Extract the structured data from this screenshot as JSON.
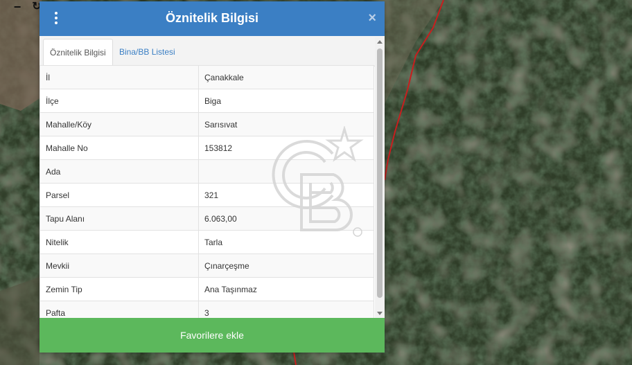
{
  "map": {
    "controls": [
      "−",
      "↻"
    ]
  },
  "panel": {
    "title": "Öznitelik Bilgisi",
    "close_label": "×",
    "tabs": [
      {
        "label": "Öznitelik Bilgisi",
        "active": true
      },
      {
        "label": "Bina/BB Listesi",
        "active": false
      }
    ],
    "rows": [
      {
        "label": "İl",
        "value": "Çanakkale"
      },
      {
        "label": "İlçe",
        "value": "Biga"
      },
      {
        "label": "Mahalle/Köy",
        "value": "Sarısıvat"
      },
      {
        "label": "Mahalle No",
        "value": "153812"
      },
      {
        "label": "Ada",
        "value": ""
      },
      {
        "label": "Parsel",
        "value": "321"
      },
      {
        "label": "Tapu Alanı",
        "value": "6.063,00"
      },
      {
        "label": "Nitelik",
        "value": "Tarla"
      },
      {
        "label": "Mevkii",
        "value": "Çınarçeşme"
      },
      {
        "label": "Zemin Tip",
        "value": "Ana Taşınmaz"
      },
      {
        "label": "Pafta",
        "value": "3"
      }
    ],
    "favorite_button": "Favorilere ekle"
  },
  "colors": {
    "header": "#3b7fc4",
    "button": "#5cb85c",
    "parcel_line": "#c81e1e"
  },
  "icons": {
    "menu": "kebab-menu-icon",
    "close": "close-icon",
    "watermark": "cb-logo-watermark"
  }
}
